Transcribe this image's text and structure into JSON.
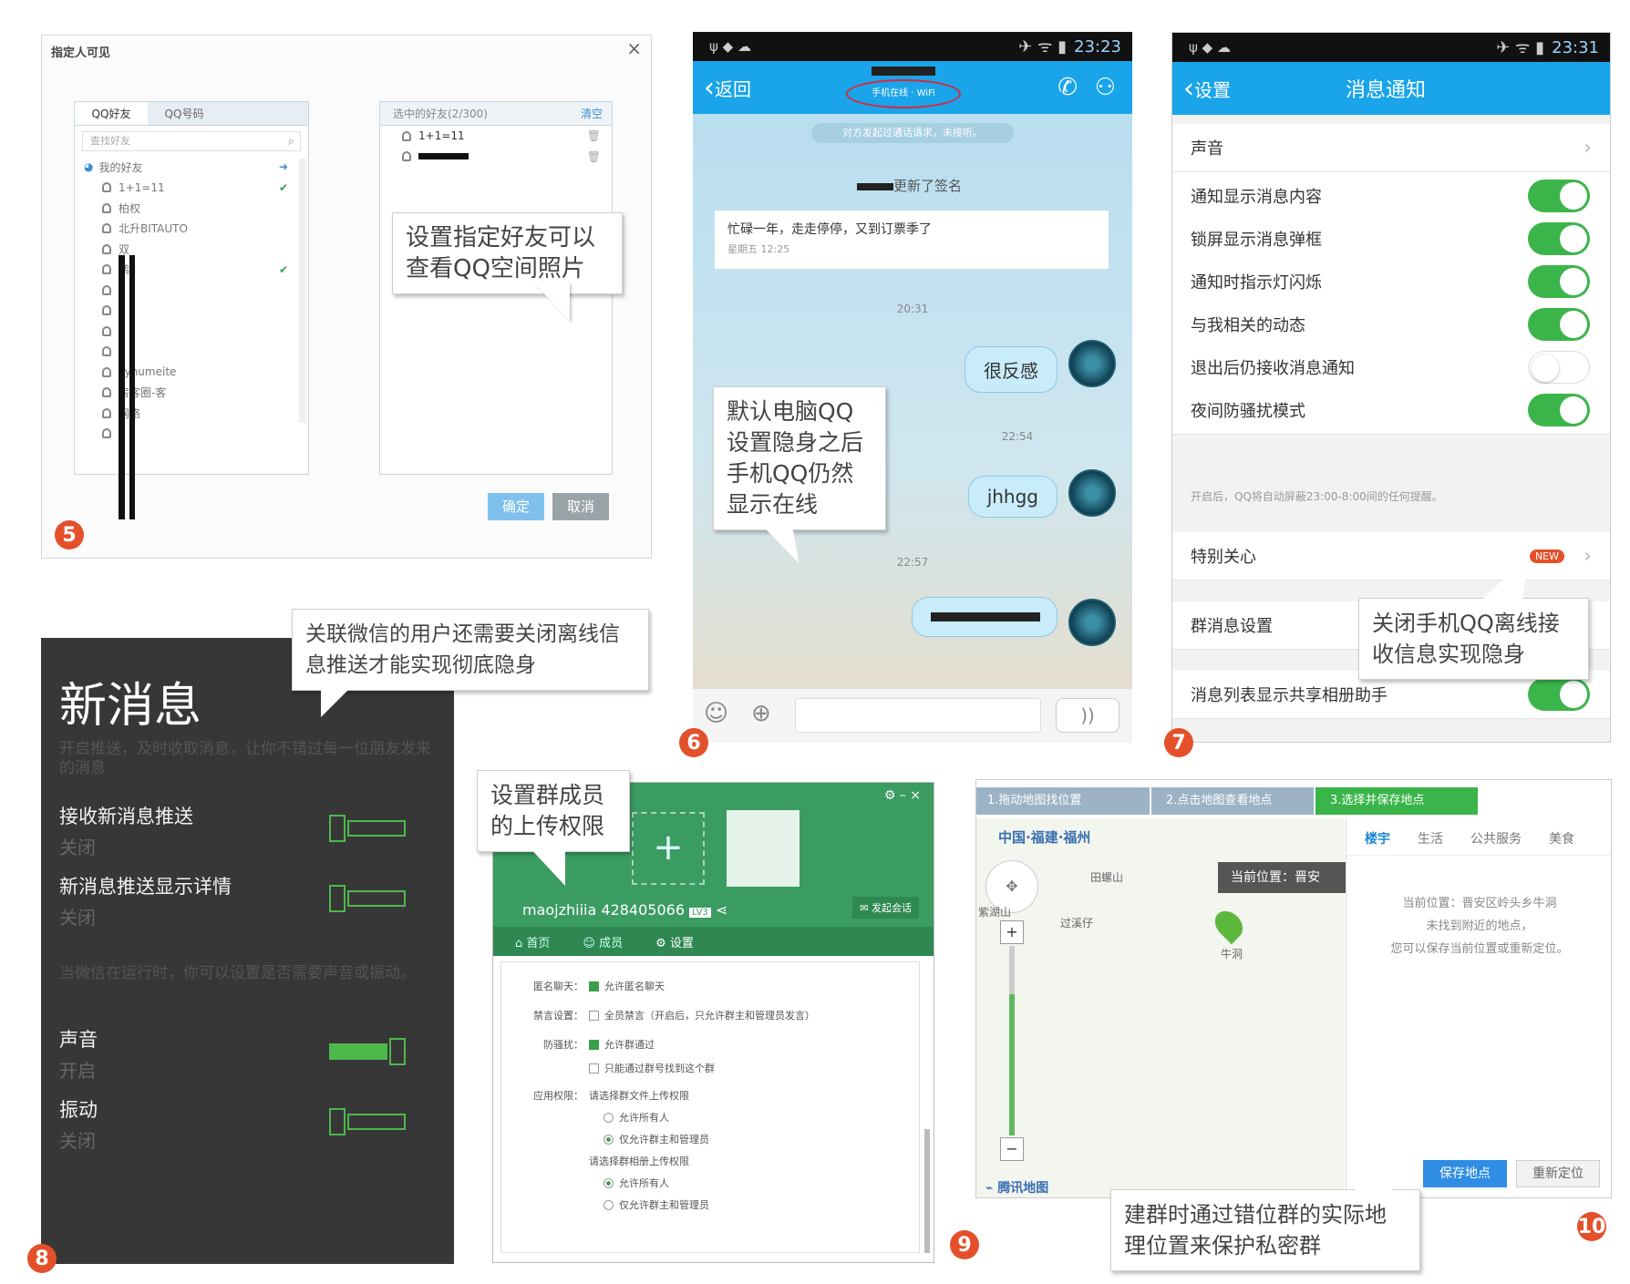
{
  "panel5": {
    "badge": "5",
    "title": "指定人可见",
    "close": "×",
    "tabs": [
      "QQ好友",
      "QQ号码"
    ],
    "search_placeholder": "查找好友",
    "group": "我的好友",
    "friends": [
      "1+1=11",
      "柏权",
      "北升BITAUTO",
      "双",
      "鹏",
      "",
      "",
      "",
      "",
      "cyhumeite",
      "房客圈-客",
      "网络",
      ""
    ],
    "selected_header": "选中的好友(2/300)",
    "clear": "清空",
    "selected": [
      "1+1=11",
      ""
    ],
    "confirm": "确定",
    "cancel": "取消",
    "callout": "设置指定好友可以查看QQ空间照片"
  },
  "panel6": {
    "badge": "6",
    "status_time": "23:23",
    "back": "返回",
    "subtitle": "手机在线 · WiFi",
    "system_msg": "对方发起过通话请求，未接听。",
    "sig_update": "更新了签名",
    "sig_text": "忙碌一年，走走停停，又到订票季了",
    "sig_time": "星期五 12:25",
    "times": [
      "20:31",
      "22:54",
      "22:57"
    ],
    "messages": [
      "很反感",
      "jhhgg",
      ""
    ],
    "voice": "))",
    "callout": "默认电脑QQ设置隐身之后手机QQ仍然显示在线"
  },
  "panel7": {
    "badge": "7",
    "status_time": "23:31",
    "back": "设置",
    "title": "消息通知",
    "rows": [
      {
        "label": "声音",
        "type": "arrow"
      },
      {
        "label": "通知显示消息内容",
        "type": "on"
      },
      {
        "label": "锁屏显示消息弹框",
        "type": "on"
      },
      {
        "label": "通知时指示灯闪烁",
        "type": "on"
      },
      {
        "label": "与我相关的动态",
        "type": "on"
      },
      {
        "label": "退出后仍接收消息通知",
        "type": "off"
      },
      {
        "label": "夜间防骚扰模式",
        "type": "on"
      }
    ],
    "night_note": "开启后，QQ将自动屏蔽23:00-8:00间的任何提醒。",
    "special": "特别关心",
    "new_badge": "NEW",
    "group_settings": "群消息设置",
    "album": "消息列表显示共享相册助手",
    "callout": "关闭手机QQ离线接收信息实现隐身"
  },
  "panel8": {
    "badge": "8",
    "title": "新消息",
    "desc": "开启推送，及时收取消息，让你不错过每一位朋友发来的消息",
    "rows": [
      {
        "label": "接收新消息推送",
        "state": "关闭",
        "on": false
      },
      {
        "label": "新消息推送显示详情",
        "state": "关闭",
        "on": false
      }
    ],
    "note": "当微信在运行时，你可以设置是否需要声音或振动。",
    "rows2": [
      {
        "label": "声音",
        "state": "开启",
        "on": true
      },
      {
        "label": "振动",
        "state": "关闭",
        "on": false
      }
    ],
    "callout": "关联微信的用户还需要关闭离线信息推送才能实现彻底隐身"
  },
  "panel9": {
    "badge": "9",
    "group_name": "maojzhiiia 428405066",
    "level": "LV3",
    "launch": "发起会话",
    "tabs": [
      "首页",
      "成员",
      "设置"
    ],
    "settings": [
      {
        "key": "匿名聊天：",
        "val": "允许匿名聊天",
        "ctrl": "cb-on"
      },
      {
        "key": "禁言设置：",
        "val": "全员禁言（开启后，只允许群主和管理员发言）",
        "ctrl": "cb"
      },
      {
        "key": "防骚扰：",
        "val": "允许群通过",
        "ctrl": "cb-on"
      },
      {
        "key": "",
        "val": "只能通过群号找到这个群",
        "ctrl": "cb"
      },
      {
        "key": "应用权限：",
        "val": "请选择群文件上传权限",
        "ctrl": ""
      },
      {
        "key": "",
        "val": "允许所有人",
        "ctrl": "rd"
      },
      {
        "key": "",
        "val": "仅允许群主和管理员",
        "ctrl": "rd-on"
      },
      {
        "key": "",
        "val": "请选择群相册上传权限",
        "ctrl": ""
      },
      {
        "key": "",
        "val": "允许所有人",
        "ctrl": "rd-on"
      },
      {
        "key": "",
        "val": "仅允许群主和管理员",
        "ctrl": "rd"
      }
    ],
    "callout": "设置群成员的上传权限"
  },
  "panel10": {
    "badge": "10",
    "steps": [
      "1.拖动地图找位置",
      "2.点击地图查看地点",
      "3.选择并保存地点"
    ],
    "location": "中国·福建·福州",
    "places": [
      "田螺山",
      "过溪仔",
      "紫湖山",
      "牛洞"
    ],
    "marker_label": "当前位置：晋安",
    "cats": [
      "楼宇",
      "生活",
      "公共服务",
      "美食"
    ],
    "info": [
      "当前位置：晋安区岭头乡牛洞",
      "未找到附近的地点，",
      "您可以保存当前位置或重新定位。"
    ],
    "save": "保存地点",
    "relocate": "重新定位",
    "brand": "腾讯地图",
    "callout": "建群时通过错位群的实际地理位置来保护私密群"
  }
}
